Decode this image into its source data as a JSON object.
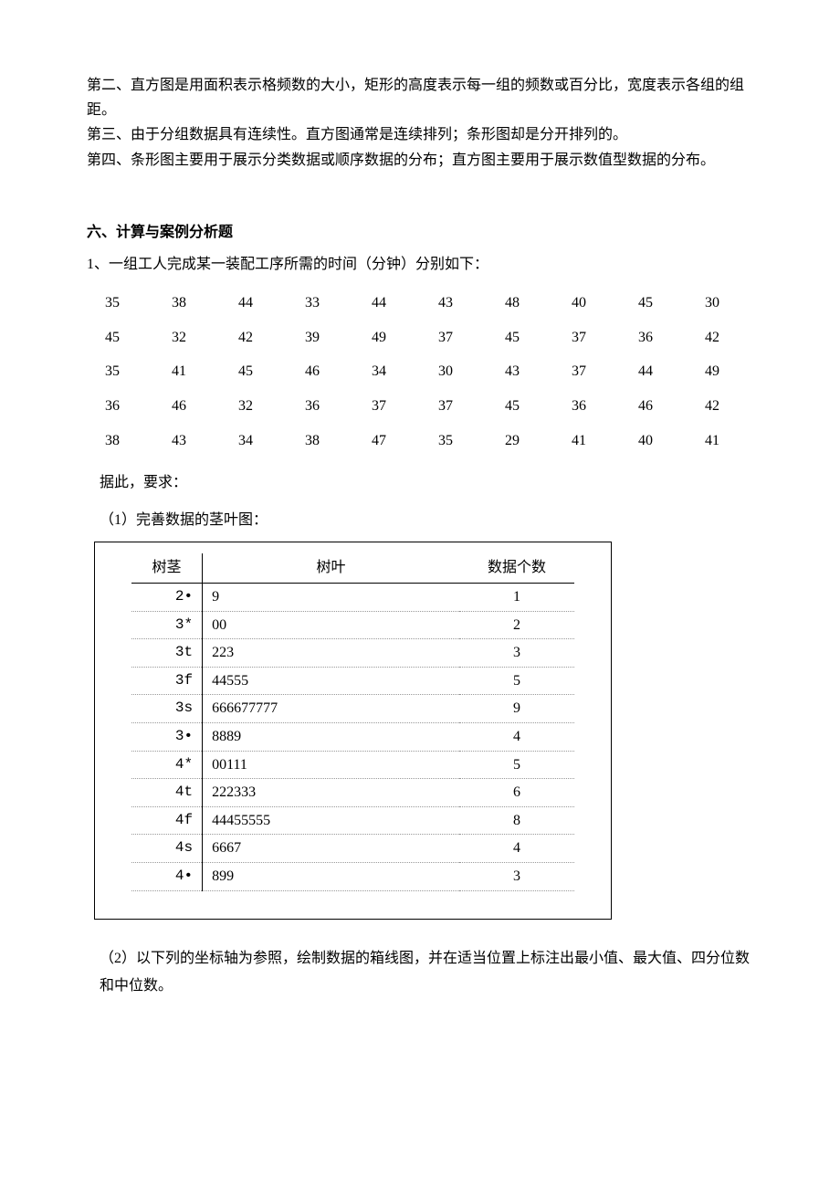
{
  "intro_paras": [
    "第二、直方图是用面积表示格频数的大小，矩形的高度表示每一组的频数或百分比，宽度表示各组的组距。",
    "第三、由于分组数据具有连续性。直方图通常是连续排列；条形图却是分开排列的。",
    "第四、条形图主要用于展示分类数据或顺序数据的分布；直方图主要用于展示数值型数据的分布。"
  ],
  "section_title": "六、计算与案例分析题",
  "q1_line": "1、一组工人完成某一装配工序所需的时间（分钟）分别如下：",
  "data_rows": [
    [
      "35",
      "38",
      "44",
      "33",
      "44",
      "43",
      "48",
      "40",
      "45",
      "30"
    ],
    [
      "45",
      "32",
      "42",
      "39",
      "49",
      "37",
      "45",
      "37",
      "36",
      "42"
    ],
    [
      "35",
      "41",
      "45",
      "46",
      "34",
      "30",
      "43",
      "37",
      "44",
      "49"
    ],
    [
      "36",
      "46",
      "32",
      "36",
      "37",
      "37",
      "45",
      "36",
      "46",
      "42"
    ],
    [
      "38",
      "43",
      "34",
      "38",
      "47",
      "35",
      "29",
      "41",
      "40",
      "41"
    ]
  ],
  "prompt": "据此，要求：",
  "sub_q1": "（1）完善数据的茎叶图：",
  "stem_headers": {
    "stem": "树茎",
    "leaf": "树叶",
    "count": "数据个数"
  },
  "stem_rows": [
    {
      "stem": "2•",
      "leaf": "9",
      "count": "1"
    },
    {
      "stem": "3*",
      "leaf": "00",
      "count": "2"
    },
    {
      "stem": "3t",
      "leaf": "223",
      "count": "3"
    },
    {
      "stem": "3f",
      "leaf": "44555",
      "count": "5"
    },
    {
      "stem": "3s",
      "leaf": "666677777",
      "count": "9"
    },
    {
      "stem": "3•",
      "leaf": "8889",
      "count": "4"
    },
    {
      "stem": "4*",
      "leaf": "00111",
      "count": "5"
    },
    {
      "stem": "4t",
      "leaf": "222333",
      "count": "6"
    },
    {
      "stem": "4f",
      "leaf": "44455555",
      "count": "8"
    },
    {
      "stem": "4s",
      "leaf": "6667",
      "count": "4"
    },
    {
      "stem": "4•",
      "leaf": "899",
      "count": "3"
    }
  ],
  "sub_q2": "（2）以下列的坐标轴为参照，绘制数据的箱线图，并在适当位置上标注出最小值、最大值、四分位数和中位数。"
}
